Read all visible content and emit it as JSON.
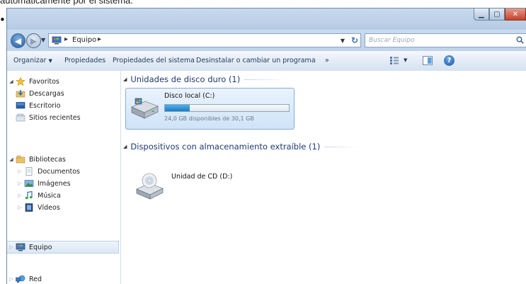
{
  "document": {
    "caption_fragment": "automáticamente por el sistema."
  },
  "window": {
    "address": {
      "segments": [
        "Equipo"
      ],
      "search_placeholder": "Buscar Equipo"
    },
    "command_bar": {
      "organize": "Organizar",
      "properties": "Propiedades",
      "system_properties": "Propiedades del sistema",
      "uninstall": "Desinstalar o cambiar un programa",
      "more": "»"
    },
    "navigation": {
      "favorites": {
        "label": "Favoritos",
        "items": [
          "Descargas",
          "Escritorio",
          "Sitios recientes"
        ]
      },
      "libraries": {
        "label": "Bibliotecas",
        "items": [
          "Documentos",
          "Imágenes",
          "Música",
          "Vídeos"
        ]
      },
      "computer": "Equipo",
      "network": "Red"
    },
    "content": {
      "hard_drives_header": "Unidades de disco duro (1)",
      "removable_header": "Dispositivos con almacenamiento extraíble (1)",
      "local_disk": {
        "name": "Disco local (C:)",
        "free_text": "24,0 GB disponibles de 30,1 GB",
        "used_fraction": 0.2
      },
      "cd_drive": {
        "name": "Unidad de CD (D:)"
      }
    }
  },
  "icons": {
    "back": "back-arrow-icon",
    "forward": "forward-arrow-icon",
    "search": "search-icon",
    "help": "help-icon",
    "close": "close-icon"
  }
}
